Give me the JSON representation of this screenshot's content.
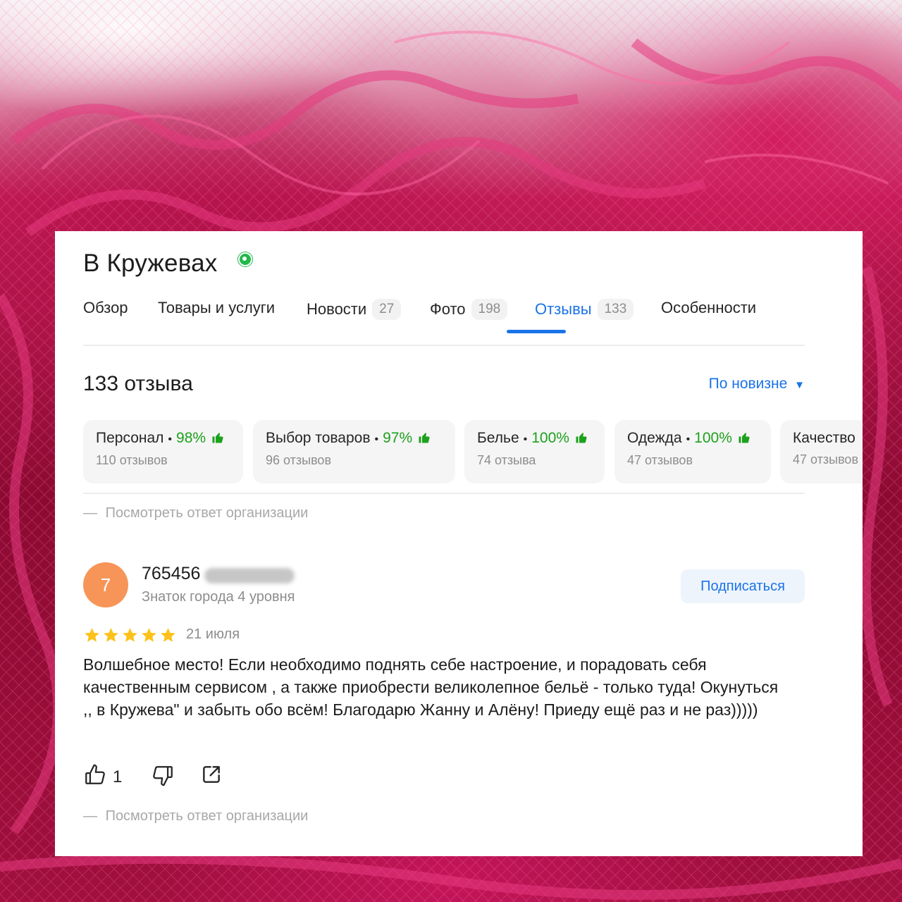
{
  "business": {
    "name": "В Кружевах"
  },
  "tabs": [
    {
      "label": "Обзор",
      "count": ""
    },
    {
      "label": "Товары и услуги",
      "count": ""
    },
    {
      "label": "Новости",
      "count": "27"
    },
    {
      "label": "Фото",
      "count": "198"
    },
    {
      "label": "Отзывы",
      "count": "133"
    },
    {
      "label": "Особенности",
      "count": ""
    }
  ],
  "active_tab": "Отзывы",
  "reviews": {
    "total_label": "133 отзыва",
    "sort_label": "По новизне",
    "aspects": [
      {
        "name": "Персонал",
        "percent": "98%",
        "count": "110 отзывов"
      },
      {
        "name": "Выбор товаров",
        "percent": "97%",
        "count": "96 отзывов"
      },
      {
        "name": "Белье",
        "percent": "100%",
        "count": "74 отзыва"
      },
      {
        "name": "Одежда",
        "percent": "100%",
        "count": "47 отзывов"
      },
      {
        "name": "Качество",
        "percent": "",
        "count": "47 отзывов"
      }
    ],
    "org_reply_link": "Посмотреть ответ организации"
  },
  "review": {
    "avatar_letter": "7",
    "author": "765456",
    "level": "Знаток города 4 уровня",
    "subscribe_label": "Подписаться",
    "rating": 5,
    "date": "21 июля",
    "text": "Волшебное место! Если необходимо поднять себе настроение, и порадовать себя качественным сервисом , а также приобрести великолепное бельё - только туда! Окунуться ,, в Кружева\" и забыть обо всём! Благодарю Жанну и Алёну! Приеду ещё раз и не раз)))))",
    "likes": "1",
    "org_reply_link": "Посмотреть ответ организации"
  },
  "colors": {
    "accent": "#1a73e8",
    "positive": "#1ca11c",
    "star": "#fcc21b",
    "avatar": "#f79558",
    "background_lace": "#b3124a"
  },
  "icons": [
    "verified-icon",
    "thumbs-up-icon",
    "dropdown-arrow-icon",
    "star-icon",
    "like-icon",
    "dislike-icon",
    "share-icon"
  ]
}
